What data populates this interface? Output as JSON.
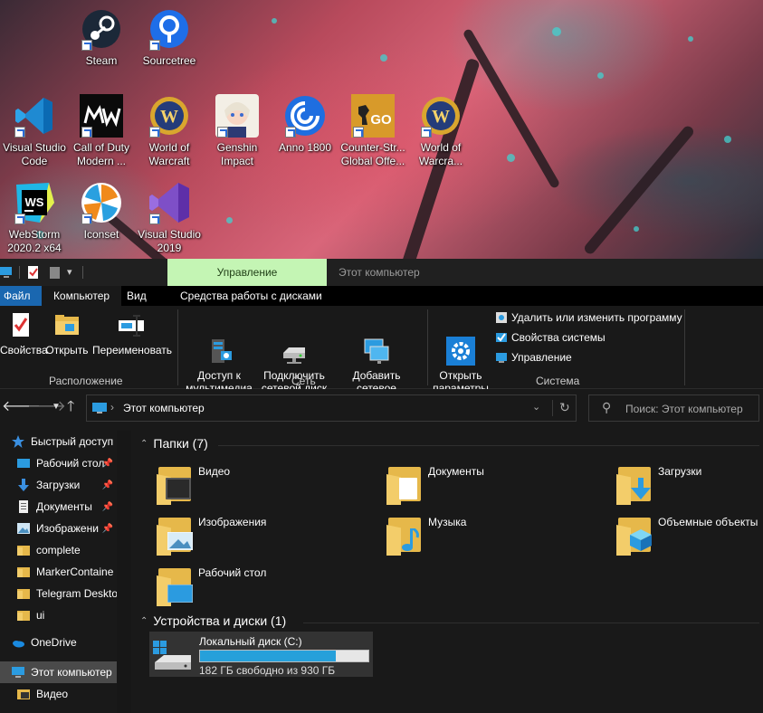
{
  "desktop": {
    "icons": [
      {
        "label": "Steam",
        "icon": "steam-icon"
      },
      {
        "label": "Sourcetree",
        "icon": "sourcetree-icon"
      },
      {
        "label": "Visual Studio\nCode",
        "icon": "vscode-icon"
      },
      {
        "label": "Call of Duty\nModern ...",
        "icon": "call-of-duty-icon"
      },
      {
        "label": "World of\nWarcraft",
        "icon": "world-of-warcraft-icon"
      },
      {
        "label": "Genshin\nImpact",
        "icon": "genshin-impact-icon"
      },
      {
        "label": "Anno 1800",
        "icon": "anno-1800-icon"
      },
      {
        "label": "Counter-Str...\nGlobal Offe...",
        "icon": "csgo-icon"
      },
      {
        "label": "World of\nWarcra...",
        "icon": "world-of-warcraft-icon"
      },
      {
        "label": "WebStorm\n2020.2 x64",
        "icon": "webstorm-icon"
      },
      {
        "label": "Iconset",
        "icon": "iconset-icon"
      },
      {
        "label": "Visual Studio\n2019",
        "icon": "visual-studio-icon"
      }
    ]
  },
  "window": {
    "context_tab": "Управление",
    "title": "Этот компьютер"
  },
  "ribbon_tabs": {
    "file": "Файл",
    "computer": "Компьютер",
    "view": "Вид",
    "disk_tools": "Средства работы с дисками"
  },
  "ribbon": {
    "location": {
      "label": "Расположение",
      "properties": "Свойства",
      "open": "Открыть",
      "rename": "Переименовать"
    },
    "network": {
      "label": "Сеть",
      "media_access": "Доступ к\nмультимедиа",
      "map_drive": "Подключить\nсетевой диск",
      "add_location": "Добавить сетевое\nрасположение"
    },
    "system": {
      "label": "Система",
      "open_settings": "Открыть\nпараметры",
      "uninstall": "Удалить или изменить программу",
      "system_properties": "Свойства системы",
      "manage": "Управление"
    }
  },
  "nav": {
    "path": "Этот компьютер",
    "search_placeholder": "Поиск: Этот компьютер"
  },
  "sidebar": {
    "items": [
      {
        "label": "Быстрый доступ",
        "icon": "star-icon"
      },
      {
        "label": "Рабочий стол",
        "icon": "desktop-icon",
        "pinned": true
      },
      {
        "label": "Загрузки",
        "icon": "download-icon",
        "pinned": true
      },
      {
        "label": "Документы",
        "icon": "document-icon",
        "pinned": true
      },
      {
        "label": "Изображени",
        "icon": "pictures-icon",
        "pinned": true
      },
      {
        "label": "complete",
        "icon": "folder-icon"
      },
      {
        "label": "MarkerContaine",
        "icon": "folder-icon"
      },
      {
        "label": "Telegram Deskto",
        "icon": "folder-icon"
      },
      {
        "label": "ui",
        "icon": "folder-icon"
      },
      {
        "label": "OneDrive",
        "icon": "onedrive-icon"
      },
      {
        "label": "Этот компьютер",
        "icon": "computer-icon"
      },
      {
        "label": "Видео",
        "icon": "video-folder-icon"
      }
    ]
  },
  "content": {
    "folders_header": "Папки (7)",
    "folders": [
      {
        "label": "Видео",
        "icon": "video-folder-icon"
      },
      {
        "label": "Документы",
        "icon": "documents-folder-icon"
      },
      {
        "label": "Загрузки",
        "icon": "downloads-folder-icon"
      },
      {
        "label": "Изображения",
        "icon": "pictures-folder-icon"
      },
      {
        "label": "Музыка",
        "icon": "music-folder-icon"
      },
      {
        "label": "Объемные объекты",
        "icon": "3d-objects-folder-icon"
      },
      {
        "label": "Рабочий стол",
        "icon": "desktop-folder-icon"
      }
    ],
    "devices_header": "Устройства и диски (1)",
    "drive": {
      "name": "Локальный диск (C:)",
      "free_text": "182 ГБ свободно из 930 ГБ",
      "used_fraction": 0.804
    }
  },
  "colors": {
    "accent": "#1a67b0",
    "context_tab_bg": "#c4f5b4",
    "folder": "#e6b84a",
    "drive_fill": "#26a0da"
  }
}
